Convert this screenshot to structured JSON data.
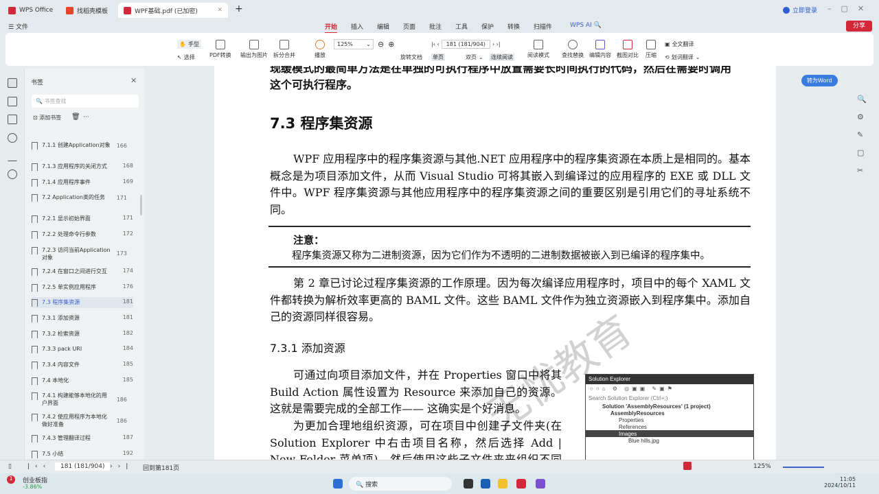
{
  "tabs": [
    {
      "label": "WPS Office"
    },
    {
      "label": "找稻壳模板"
    },
    {
      "label": "WPF基础.pdf (已加密)"
    }
  ],
  "title_right": {
    "login": "立即登录"
  },
  "menu": {
    "file": "文件",
    "items": [
      "开始",
      "插入",
      "编辑",
      "页面",
      "批注",
      "工具",
      "保护",
      "转换",
      "扫描件"
    ],
    "ai": "WPS AI",
    "share": "分享"
  },
  "ribbon": {
    "hand": "手型",
    "select": "选择",
    "pdf_convert": "PDF转换",
    "export_image": "输出为图片",
    "split_merge": "拆分合并",
    "play": "播放",
    "zoom": "125%",
    "rotate": "旋转文档",
    "single": "单页",
    "double": "双页",
    "continuous": "连续阅读",
    "page_input": "181 (181/904)",
    "read_mode": "阅读模式",
    "find_replace": "查找替换",
    "edit_content": "编辑内容",
    "screenshot_compare": "截图对比",
    "compress": "压缩",
    "full_translate": "全文翻译",
    "word_translate": "划词翻译"
  },
  "panel": {
    "title": "书签",
    "search_placeholder": "书签查找",
    "add": "添加书签",
    "more": "···",
    "items": [
      {
        "label": "7.1.1 创建Application对象",
        "page": "166"
      },
      {
        "label": "7.1.3 应用程序的关闭方式",
        "page": "168"
      },
      {
        "label": "7.1.4 应用程序事件",
        "page": "169"
      },
      {
        "label": "7.2 Application类的任务",
        "page": "171"
      },
      {
        "label": "7.2.1 显示初始界面",
        "page": "171"
      },
      {
        "label": "7.2.2 处理命令行参数",
        "page": "172"
      },
      {
        "label": "7.2.3 访问当前Application对象",
        "page": "173"
      },
      {
        "label": "7.2.4 在窗口之间进行交互",
        "page": "174"
      },
      {
        "label": "7.2.5 单实例应用程序",
        "page": "176"
      },
      {
        "label": "7.3 程序集资源",
        "page": "181"
      },
      {
        "label": "7.3.1 添加资源",
        "page": "181"
      },
      {
        "label": "7.3.2 检索资源",
        "page": "182"
      },
      {
        "label": "7.3.3 pack URI",
        "page": "184"
      },
      {
        "label": "7.3.4 内容文件",
        "page": "185"
      },
      {
        "label": "7.4 本地化",
        "page": "185"
      },
      {
        "label": "7.4.1 构建能够本地化的用户界面",
        "page": "186"
      },
      {
        "label": "7.4.2 使应用程序为本地化做好准备",
        "page": "186"
      },
      {
        "label": "7.4.3 管理翻译过程",
        "page": "187"
      },
      {
        "label": "7.5 小结",
        "page": "192"
      }
    ]
  },
  "doc": {
    "top1": "现缓模式的最简单方法是在单独的可执行程序中放置需要长时间执行的代码，然后在需要时调用",
    "top2": "这个可执行程序。",
    "h73": "7.3    程序集资源",
    "p1": "WPF 应用程序中的程序集资源与其他.NET 应用程序中的程序集资源在本质上是相同的。基本概念是为项目添加文件，从而 Visual Studio 可将其嵌入到编译过的应用程序的 EXE 或 DLL 文件中。WPF 程序集资源与其他应用程序中的程序集资源之间的重要区别是引用它们的寻址系统不同。",
    "note_title": "注意：",
    "note": "程序集资源又称为二进制资源，因为它们作为不透明的二进制数据被嵌入到已编译的程序集中。",
    "p2": "第 2 章已讨论过程序集资源的工作原理。因为每次编译应用程序时，项目中的每个 XAML 文件都转换为解析效率更高的 BAML 文件。这些 BAML 文件作为独立资源嵌入到程序集中。添加自己的资源同样很容易。",
    "h731": "7.3.1    添加资源",
    "p3": "可通过向项目添加文件，并在 Properties 窗口中将其 Build Action 属性设置为 Resource 来添加自己的资源。这就是需要完成的全部工作—— 这确实是个好消息。",
    "p4": "为更加合理地组织资源，可在项目中创建子文件夹(在 Solution Explorer 中右击项目名称，然后选择 Add | New Folder 菜单项)，然后使用这些子文件夹来组织不同类别的资",
    "watermark": "无忧教育"
  },
  "solution_explorer": {
    "title": "Solution Explorer",
    "search": "Search Solution Explorer (Ctrl+;)",
    "tree": [
      "Solution 'AssemblyResources' (1 project)",
      "AssemblyResources",
      "Properties",
      "References",
      "Images",
      "Blue hills.jpg"
    ]
  },
  "to_word": "转为Word",
  "status": {
    "page": "181 (181/904)",
    "back": "回到第181页",
    "zoom": "125%"
  },
  "taskbar": {
    "search": "搜索",
    "stock_name": "创业板指",
    "stock_change": "-3.86%",
    "badge": "1",
    "time": "11:05",
    "date": "2024/10/11"
  },
  "colors": {
    "accent": "#d3273a",
    "blue": "#3a63c7"
  }
}
